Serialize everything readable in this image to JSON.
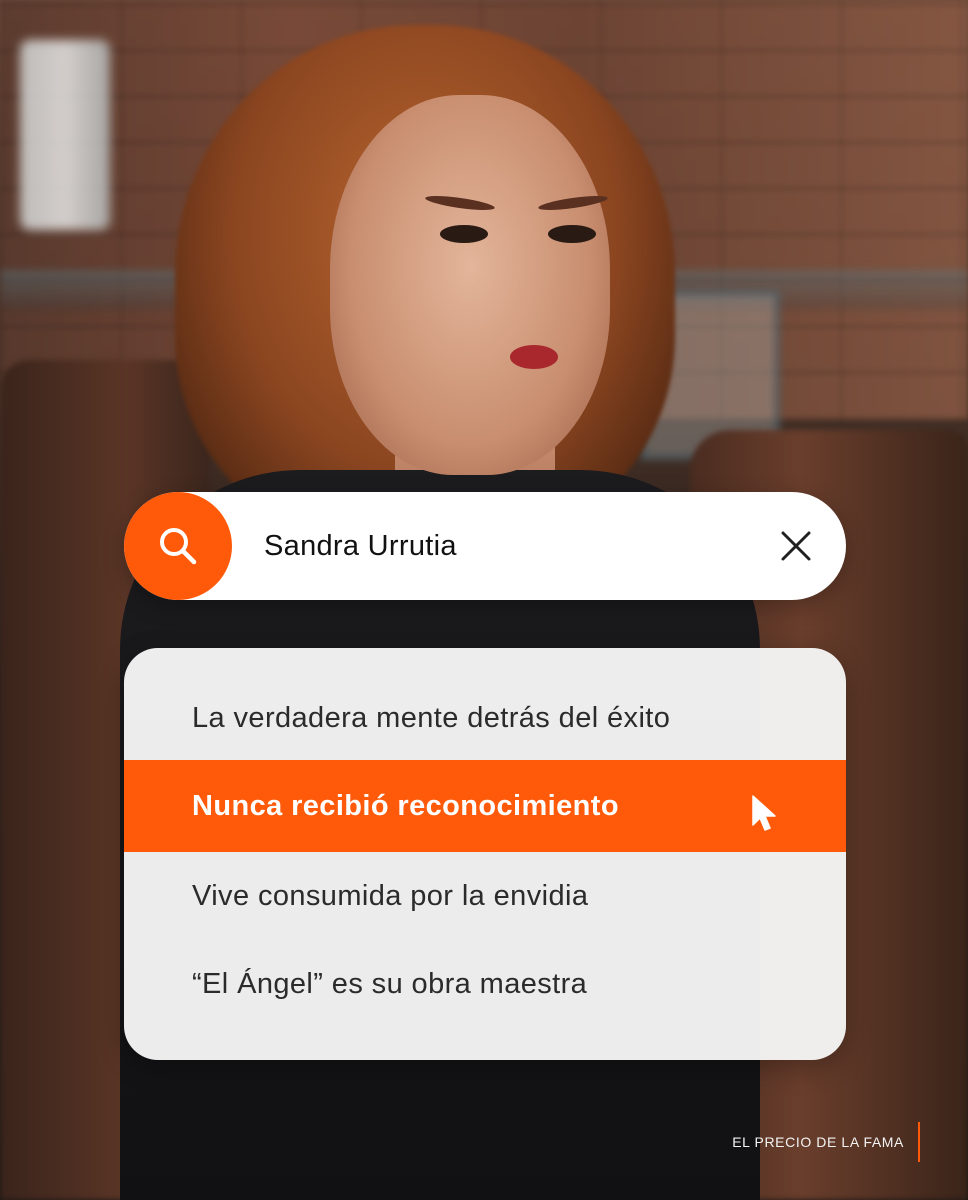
{
  "search": {
    "query": "Sandra Urrutia",
    "icon": "search-icon",
    "clear_icon": "close-icon",
    "accent_color": "#ff5a0a"
  },
  "suggestions": [
    {
      "label": "La verdadera mente detrás del éxito",
      "selected": false
    },
    {
      "label": "Nunca recibió reconocimiento",
      "selected": true
    },
    {
      "label": "Vive consumida por la envidia",
      "selected": false
    },
    {
      "label": "“El Ángel” es su obra maestra",
      "selected": false
    }
  ],
  "pointer_icon": "mouse-pointer-icon",
  "footer": {
    "brand_text": "EL PRECIO DE LA FAMA"
  }
}
